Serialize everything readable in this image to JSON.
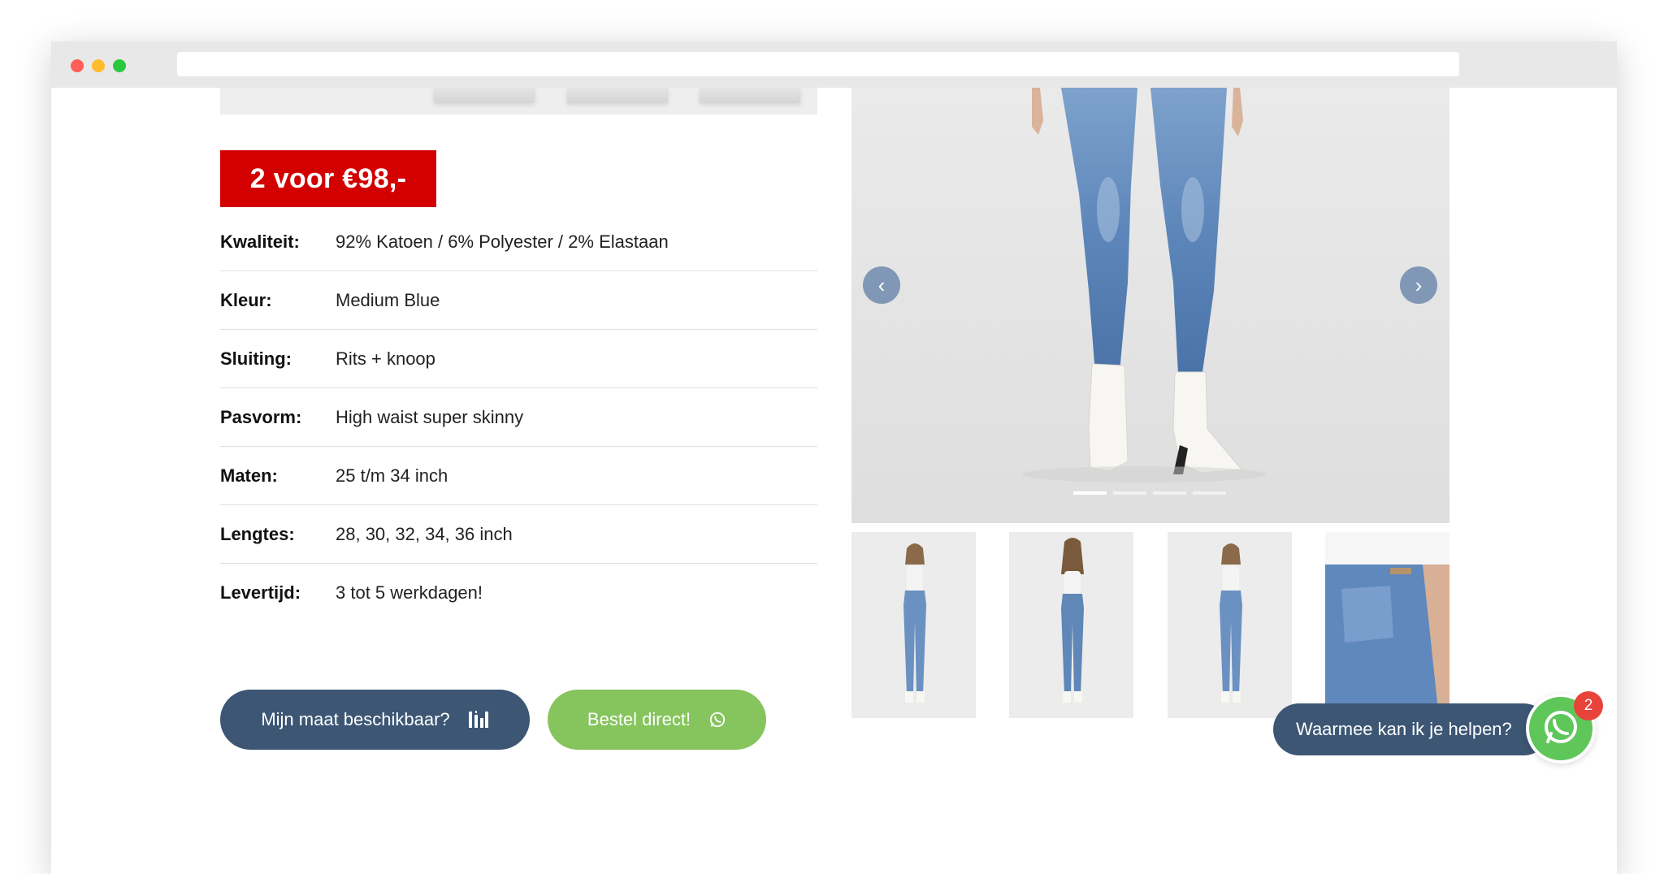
{
  "promo": {
    "label": "2 voor €98,-"
  },
  "specs": [
    {
      "label": "Kwaliteit:",
      "value": "92% Katoen / 6% Polyester / 2% Elastaan"
    },
    {
      "label": "Kleur:",
      "value": "Medium Blue"
    },
    {
      "label": "Sluiting:",
      "value": "Rits + knoop"
    },
    {
      "label": "Pasvorm:",
      "value": "High waist super skinny"
    },
    {
      "label": "Maten:",
      "value": "25 t/m 34 inch"
    },
    {
      "label": "Lengtes:",
      "value": "28, 30, 32, 34, 36 inch"
    },
    {
      "label": "Levertijd:",
      "value": "3 tot 5 werkdagen!"
    }
  ],
  "buttons": {
    "size_label": "Mijn maat beschikbaar?",
    "size_icon": "size-chart-icon",
    "order_label": "Bestel direct!",
    "order_icon": "whatsapp-icon"
  },
  "gallery": {
    "slide_count": 4,
    "active_slide": 1,
    "thumbnails": [
      "model-front",
      "model-back",
      "model-front-2",
      "jeans-back-detail"
    ]
  },
  "chat": {
    "prompt": "Waarmee kan ik je helpen?",
    "badge_count": "2",
    "icon": "whatsapp-icon"
  },
  "colors": {
    "promo_red": "#d20000",
    "navy": "#3c5674",
    "green": "#86c45d",
    "whatsapp_green": "#5fc65a",
    "badge_red": "#e8433b"
  }
}
